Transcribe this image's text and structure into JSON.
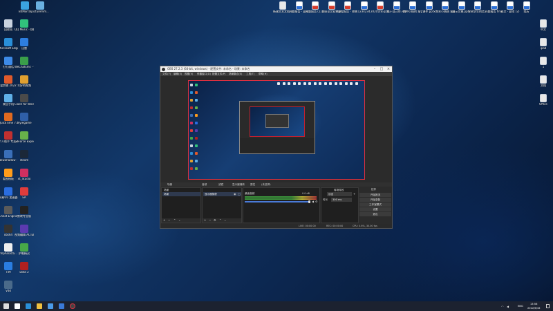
{
  "desktop": {
    "left_icons": [
      {
        "label": "回收站",
        "color": "#c9d3df"
      },
      {
        "label": "QQ Music - 快捷方式",
        "color": "#31c27c"
      },
      {
        "label": "Microsoft Edge",
        "color": "#2a8fd8"
      },
      {
        "label": "迅雷",
        "color": "#2d7ee0"
      },
      {
        "label": "钉钉通话",
        "color": "#3d8ae8"
      },
      {
        "label": "WeChatsms - 快捷方式",
        "color": "#3a9e4a"
      },
      {
        "label": "爱剪辑 2022",
        "color": "#e05a2b"
      },
      {
        "label": "写好的视频",
        "color": "#e0a030"
      },
      {
        "label": "来自手机",
        "color": "#5fb0e8"
      },
      {
        "label": "Clash for Windows",
        "color": "#4a4a4a"
      },
      {
        "label": "QuickTime 7.1",
        "color": "#e06a20"
      },
      {
        "label": "myiegame",
        "color": "#2f5fa8"
      },
      {
        "label": "个人助手 专注3.1",
        "color": "#c03030"
      },
      {
        "label": "GeForce Experience",
        "color": "#67b14a"
      },
      {
        "label": "NewShadow - 快捷方式",
        "color": "#3a6fb8"
      },
      {
        "label": "steam",
        "color": "#1b2838"
      },
      {
        "label": "看图模板",
        "color": "#ff9c1a"
      },
      {
        "label": "xt_Studio",
        "color": "#d03060"
      },
      {
        "label": "网易UU 加速器",
        "color": "#2a6de0"
      },
      {
        "label": "EA",
        "color": "#e03c3c"
      },
      {
        "label": "Cheat Engine",
        "color": "#5a5a5a"
      },
      {
        "label": "剪映专业版",
        "color": "#222222"
      },
      {
        "label": "obs64",
        "color": "#333333"
      },
      {
        "label": "视频编辑 ACTube",
        "color": "#5a3ab0"
      },
      {
        "label": "fmpAssista...",
        "color": "#eeeeee"
      },
      {
        "label": "护眼精灵",
        "color": "#48a848"
      },
      {
        "label": "TIM",
        "color": "#2a7de0"
      },
      {
        "label": "Dota 2",
        "color": "#b02020"
      },
      {
        "label": "Vdd",
        "color": "#4a6a8a"
      }
    ],
    "left_icons_top_row": [
      {
        "label": "BitMorral",
        "color": "#3ba3e0"
      },
      {
        "label": "picturemm...",
        "color": "#6ab0e0"
      }
    ],
    "top_files": [
      {
        "label": "新建文本文档.txt",
        "style": "gray"
      },
      {
        "label": "开题报告 - 副本.docx",
        "style": "blue"
      },
      {
        "label": "开题报告 (1).pdf",
        "style": "red"
      },
      {
        "label": "毕业论文初稿.pdf",
        "style": "red"
      },
      {
        "label": "课程报告 - 终稿.pdf",
        "style": "red"
      },
      {
        "label": "1234234",
        "style": "blue"
      },
      {
        "label": "2020学年论文.pdf",
        "style": "red"
      },
      {
        "label": "属于自己的 开学报告",
        "style": "blue"
      },
      {
        "label": "期中小结的 报告.docx",
        "style": "blue"
      },
      {
        "label": "课件.pptx",
        "style": "blue"
      },
      {
        "label": "期末小结结 报告.docx",
        "style": "blue"
      },
      {
        "label": "演示文稿.pptx",
        "style": "blue"
      },
      {
        "label": "写给学生的信.docx",
        "style": "blue"
      },
      {
        "label": "开题报告 final",
        "style": "blue"
      },
      {
        "label": "论文 - 副本 (2)",
        "style": "blue"
      },
      {
        "label": "简历",
        "style": "blue"
      }
    ],
    "right_files": [
      {
        "label": "中文",
        "style": "gray"
      },
      {
        "label": "ipad",
        "style": "gray"
      },
      {
        "label": "1",
        "style": "gray"
      },
      {
        "label": "文档",
        "style": "gray"
      },
      {
        "label": "Office",
        "style": "gray"
      }
    ]
  },
  "obs": {
    "title": "OBS 27.2.3 (64-bit, windows) - 配置文件: 未命名 - 场景: 未命名",
    "menu": [
      "文件(F)",
      "编辑(E)",
      "视图(V)",
      "停靠窗口(D)",
      "配置文件(P)",
      "场景集合(S)",
      "工具(T)",
      "帮助(H)"
    ],
    "dock_headers": [
      "场景",
      "音频",
      "滤镜",
      "显示器捕获",
      "属性",
      "(未选择)"
    ],
    "scenes_title": "场景",
    "scene_item": "场景",
    "sources_title": "显示器捕获",
    "mixer_title": "混音器",
    "mixer_track": "桌面音频",
    "mixer_db": "0.0 dB",
    "transitions_title": "转场特效",
    "transition_value": "淡出",
    "duration_label": "时长",
    "duration_value": "300 ms",
    "controls_title": "控件",
    "controls": [
      "开始推流",
      "开始录制",
      "工作室模式",
      "设置",
      "退出"
    ],
    "status": [
      "LIVE: 00:00:00",
      "REC: 00:00:00",
      "CPU: 0.6%, 30.00 fps"
    ]
  },
  "taskbar": {
    "time": "13:56",
    "date": "2022/6/16",
    "lang": "ENG",
    "apps": [
      {
        "name": "windows-start-icon",
        "color": "#dddddd"
      },
      {
        "name": "search-icon",
        "color": "#ffffff"
      },
      {
        "name": "edge-icon",
        "color": "#2a8fd8"
      },
      {
        "name": "explorer-icon",
        "color": "#f0c040"
      },
      {
        "name": "store-icon",
        "color": "#4a9ae8"
      },
      {
        "name": "mail-icon",
        "color": "#3a7ad8"
      },
      {
        "name": "obs-icon",
        "color": "#cfcfcf"
      }
    ]
  }
}
